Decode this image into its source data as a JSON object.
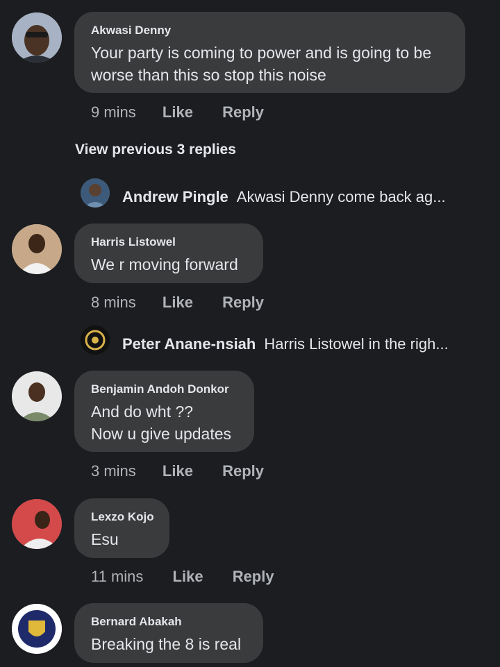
{
  "comments": [
    {
      "author": "Akwasi Denny",
      "lines": [
        "Your party is coming to power and is going to be",
        "worse than this so stop this noise"
      ],
      "time": "9 mins",
      "like": "Like",
      "reply": "Reply"
    },
    {
      "author": "Harris Listowel",
      "lines": [
        "We r moving forward"
      ],
      "time": "8 mins",
      "like": "Like",
      "reply": "Reply"
    },
    {
      "author": "Benjamin Andoh Donkor",
      "lines": [
        "And do wht ??",
        "Now u give updates"
      ],
      "time": "3 mins",
      "like": "Like",
      "reply": "Reply"
    },
    {
      "author": "Lexzo Kojo",
      "lines": [
        "Esu"
      ],
      "time": "11 mins",
      "like": "Like",
      "reply": "Reply"
    },
    {
      "author": "Bernard Abakah",
      "lines": [
        "Breaking the 8 is real"
      ]
    }
  ],
  "view_previous": "View previous 3 replies",
  "replies": [
    {
      "author": "Andrew Pingle",
      "preview": "Akwasi Denny come back ag..."
    },
    {
      "author": "Peter Anane-nsiah",
      "preview": "Harris Listowel in the righ..."
    }
  ],
  "colors": {
    "background": "#1c1d20",
    "bubble": "#3a3b3c",
    "text": "#e4e6eb",
    "secondary": "#b0b3b8"
  }
}
